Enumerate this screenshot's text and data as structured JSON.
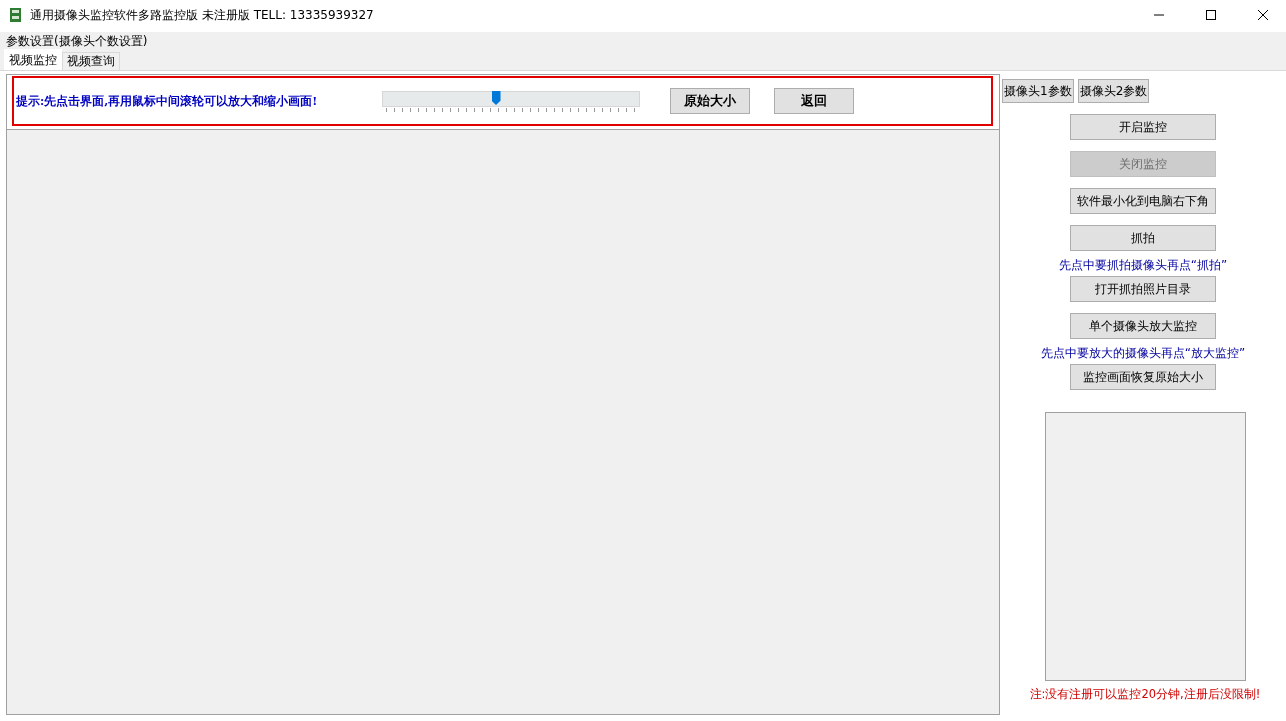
{
  "window": {
    "title": "通用摄像头监控软件多路监控版 未注册版 TELL: 13335939327"
  },
  "menu": [
    "参数设置(摄像头个数设置)"
  ],
  "tabs": [
    {
      "label": "视频监控",
      "selected": true
    },
    {
      "label": "视频查询",
      "selected": false
    }
  ],
  "toolbar": {
    "hint": "提示:先点击界面,再用鼠标中间滚轮可以放大和缩小画面!",
    "zoom_slider": {
      "level": 0.44
    },
    "buttons": [
      "原始大小",
      "返回"
    ]
  },
  "camera_buttons": [
    "摄像头1参数",
    "摄像头2参数"
  ],
  "controls": [
    {
      "kind": "button",
      "label": "开启监控",
      "disabled": false
    },
    {
      "kind": "button",
      "label": "关闭监控",
      "disabled": true
    },
    {
      "kind": "button",
      "label": "软件最小化到电脑右下角",
      "disabled": false
    },
    {
      "kind": "button",
      "label": "抓拍",
      "disabled": false
    },
    {
      "kind": "hint",
      "label": "先点中要抓拍摄像头再点“抓拍”"
    },
    {
      "kind": "button",
      "label": "打开抓拍照片目录",
      "disabled": false
    },
    {
      "kind": "button",
      "label": "单个摄像头放大监控",
      "disabled": false
    },
    {
      "kind": "hint",
      "label": "先点中要放大的摄像头再点“放大监控”"
    },
    {
      "kind": "button",
      "label": "监控画面恢复原始大小",
      "disabled": false
    }
  ],
  "notice": "注:没有注册可以监控20分钟,注册后没限制!"
}
